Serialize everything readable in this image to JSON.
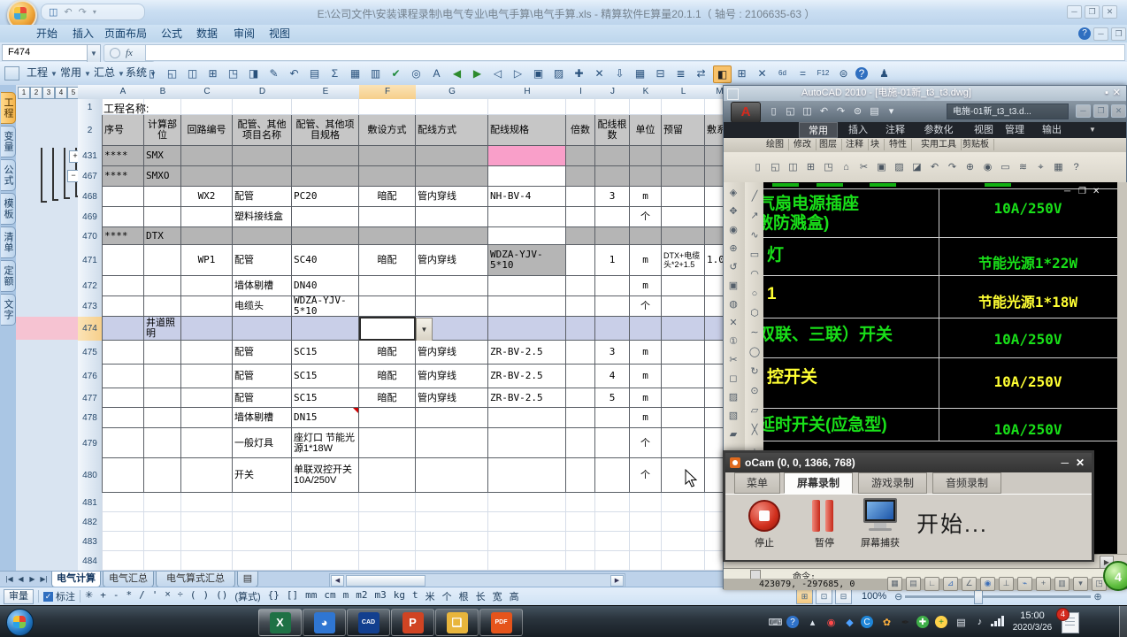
{
  "excel": {
    "title": "E:\\公司文件\\安装课程录制\\电气专业\\电气手算\\电气手算.xls - 精算软件E算量20.1.1（ 轴号 : 2106635-63 ）",
    "ribbon_tabs": [
      "开始",
      "插入",
      "页面布局",
      "公式",
      "数据",
      "审阅",
      "视图"
    ],
    "name_box": "F474",
    "fx_label": "fx",
    "addin_menus": [
      "工程",
      "常用",
      "汇总",
      "系统"
    ],
    "toolbar_icons": [
      {
        "g": "▯",
        "n": "new-icon"
      },
      {
        "g": "◱",
        "n": "open-icon"
      },
      {
        "g": "◫",
        "n": "save-icon"
      },
      {
        "g": "⊞",
        "n": "save-all-icon"
      },
      {
        "g": "◳",
        "n": "print-preview-icon"
      },
      {
        "g": "◨",
        "n": "export-icon"
      },
      {
        "g": "✎",
        "n": "edit-icon"
      },
      {
        "g": "↶",
        "n": "undo-icon"
      },
      {
        "g": "▤",
        "n": "calculator-icon"
      },
      {
        "g": "Σ",
        "n": "sum-icon"
      },
      {
        "g": "▦",
        "n": "table-icon"
      },
      {
        "g": "▥",
        "n": "table-add-icon"
      },
      {
        "g": "✔",
        "n": "check-icon"
      },
      {
        "g": "◎",
        "n": "find-icon"
      },
      {
        "g": "A",
        "n": "font-icon"
      },
      {
        "g": "◀",
        "n": "back-icon"
      },
      {
        "g": "▶",
        "n": "forward-icon"
      },
      {
        "g": "◁",
        "n": "prev-icon"
      },
      {
        "g": "▷",
        "n": "next-icon"
      },
      {
        "g": "▣",
        "n": "copy-icon"
      },
      {
        "g": "▨",
        "n": "paste-icon"
      },
      {
        "g": "✚",
        "n": "insert-icon"
      },
      {
        "g": "✕",
        "n": "delete-icon"
      },
      {
        "g": "⇩",
        "n": "sort-icon"
      },
      {
        "g": "▦",
        "n": "grid-icon"
      },
      {
        "g": "⊟",
        "n": "merge-icon"
      },
      {
        "g": "≣",
        "n": "list-icon"
      },
      {
        "g": "⇄",
        "n": "swap-icon"
      },
      {
        "g": "◧",
        "n": "fill-toggle-icon",
        "hl": true
      },
      {
        "g": "⊞",
        "n": "insert-cells-icon"
      },
      {
        "g": "✕",
        "n": "close-icon"
      },
      {
        "g": "6d",
        "n": "units-icon"
      },
      {
        "g": "=",
        "n": "equals-icon"
      },
      {
        "g": "F12",
        "n": "f12-icon"
      },
      {
        "g": "⊜",
        "n": "record-icon"
      },
      {
        "g": "?",
        "n": "help-icon"
      },
      {
        "g": "♟",
        "n": "qq-icon"
      }
    ],
    "outline_levels": [
      "1",
      "2",
      "3",
      "4",
      "5"
    ],
    "side_tabs": [
      "工程",
      "变量",
      "公式",
      "模板",
      "清单",
      "定额",
      "文字"
    ],
    "columns": [
      "A",
      "B",
      "C",
      "D",
      "E",
      "F",
      "G",
      "H",
      "I",
      "J",
      "K",
      "L",
      "M"
    ],
    "sheet_tabs": [
      "电气计算",
      "电气汇总",
      "电气算式汇总"
    ],
    "status_button": "审量",
    "status_checkbox": "标注",
    "status_symbols": [
      "✳",
      "+",
      "-",
      "*",
      "/",
      "'",
      "×",
      "÷",
      "(",
      ")",
      "()",
      "(算式)",
      "{}",
      "[]",
      "mm",
      "cm",
      "m",
      "m2",
      "m3",
      "kg",
      "t",
      "米",
      "个",
      "根",
      "长",
      "宽",
      "高"
    ],
    "zoom_level": "100%"
  },
  "sheet": {
    "title_label": "工程名称:",
    "header": {
      "A": "序号",
      "B": "计算部位",
      "C": "回路编号",
      "D": "配管、其他项目名称",
      "E": "配管、其他项目规格",
      "F": "敷设方式",
      "G": "配线方式",
      "H": "配线规格",
      "I": "倍数",
      "J": "配线根数",
      "K": "单位",
      "L": "预留",
      "M": "敷系"
    },
    "rows": [
      {
        "num": "1",
        "type": "title"
      },
      {
        "num": "2",
        "type": "header"
      },
      {
        "num": "431",
        "type": "group",
        "cells": {
          "A": "****",
          "B": "SMX"
        },
        "h_fill": "pink"
      },
      {
        "num": "467",
        "type": "group",
        "cells": {
          "A": "****",
          "B": "SMXO"
        },
        "h_fill": "white"
      },
      {
        "num": "468",
        "type": "data",
        "cells": {
          "C": "WX2",
          "D": "配管",
          "E": "PC20",
          "F": "暗配",
          "G": "管内穿线",
          "H": "NH-BV-4",
          "J": "3",
          "K": "m"
        }
      },
      {
        "num": "469",
        "type": "data",
        "cells": {
          "D": "塑料接线盒",
          "K": "个"
        }
      },
      {
        "num": "470",
        "type": "group",
        "cells": {
          "A": "****",
          "B": "DTX"
        },
        "h_fill": "white"
      },
      {
        "num": "471",
        "type": "data",
        "cells": {
          "C": "WP1",
          "D": "配管",
          "E": "SC40",
          "F": "暗配",
          "G": "管内穿线",
          "H": "WDZA-YJV-5*10",
          "J": "1",
          "K": "m",
          "L": "DTX+电缆头*2+1.5",
          "M": "1.0"
        },
        "gray": [
          "H"
        ]
      },
      {
        "num": "472",
        "type": "data",
        "cells": {
          "D": "墙体剔槽",
          "E": "DN40",
          "K": "m"
        }
      },
      {
        "num": "473",
        "type": "data",
        "cells": {
          "D": "电缆头",
          "E": "WDZA-YJV-5*10",
          "K": "个"
        }
      },
      {
        "num": "474",
        "type": "selected",
        "cells": {
          "B": "井道照明"
        },
        "active": "F"
      },
      {
        "num": "475",
        "type": "data",
        "cells": {
          "D": "配管",
          "E": "SC15",
          "F": "暗配",
          "G": "管内穿线",
          "H": "ZR-BV-2.5",
          "J": "3",
          "K": "m"
        }
      },
      {
        "num": "476",
        "type": "data",
        "cells": {
          "D": "配管",
          "E": "SC15",
          "F": "暗配",
          "G": "管内穿线",
          "H": "ZR-BV-2.5",
          "J": "4",
          "K": "m"
        }
      },
      {
        "num": "477",
        "type": "data",
        "cells": {
          "D": "配管",
          "E": "SC15",
          "F": "暗配",
          "G": "管内穿线",
          "H": "ZR-BV-2.5",
          "J": "5",
          "K": "m"
        }
      },
      {
        "num": "478",
        "type": "data",
        "cells": {
          "D": "墙体剔槽",
          "E": "DN15",
          "K": "m"
        },
        "comment": "E"
      },
      {
        "num": "479",
        "type": "data",
        "cells": {
          "D": "一般灯具",
          "E": "座灯口 节能光源1*18W",
          "K": "个"
        }
      },
      {
        "num": "480",
        "type": "data",
        "cells": {
          "D": "开关",
          "E": "单联双控开关 10A/250V",
          "K": "个"
        }
      },
      {
        "num": "481",
        "type": "empty"
      },
      {
        "num": "482",
        "type": "empty"
      },
      {
        "num": "483",
        "type": "empty"
      },
      {
        "num": "484",
        "type": "empty"
      }
    ]
  },
  "autocad": {
    "title": "AutoCAD 2010 - [电施-01新_t3_t3.dwg]",
    "doc_tab": "电施-01新_t3_t3.d...",
    "ribbon_tabs": [
      "常用",
      "插入",
      "注释",
      "参数化",
      "视图",
      "管理",
      "输出"
    ],
    "panels": [
      "绘图",
      "修改",
      "图层",
      "注释",
      "块",
      "特性",
      "实用工具",
      "剪贴板"
    ],
    "table_rows": [
      {
        "left": "气扇电源插座",
        "left2": "敷防溅盒)",
        "right": "10A/250V",
        "color": "green"
      },
      {
        "left": "灯",
        "right": "节能光源1*22W",
        "color": "green"
      },
      {
        "left": "1",
        "right": "节能光源1*18W",
        "color": "yellow"
      },
      {
        "left": "双联、三联）开关",
        "right": "10A/250V",
        "color": "green"
      },
      {
        "left": "控开关",
        "right": "10A/250V",
        "color": "yellow"
      },
      {
        "left": "延时开关(应急型)",
        "right": "10A/250V",
        "color": "green"
      }
    ],
    "command_label": "命令:",
    "coords": "423079, -297685, 0"
  },
  "ocam": {
    "title": "oCam (0, 0, 1366, 768)",
    "tabs": [
      "菜单",
      "屏幕录制",
      "游戏录制",
      "音频录制"
    ],
    "active_tab": "屏幕录制",
    "buttons": [
      "停止",
      "暂停",
      "屏幕捕获"
    ],
    "status_text": "开始..."
  },
  "taskbar": {
    "time": "15:00",
    "date": "2020/3/26",
    "badge": "4",
    "ball_badge": "4",
    "cad_label": "CAD",
    "pdf_label": "PDF"
  },
  "colors": {
    "accent_pink": "#f99fc9",
    "row_gray": "#b5b5b5",
    "header_gray": "#c6c6c6",
    "selection": "#c9cfe8",
    "cad_green": "#19e019",
    "cad_yellow": "#ffff33"
  }
}
